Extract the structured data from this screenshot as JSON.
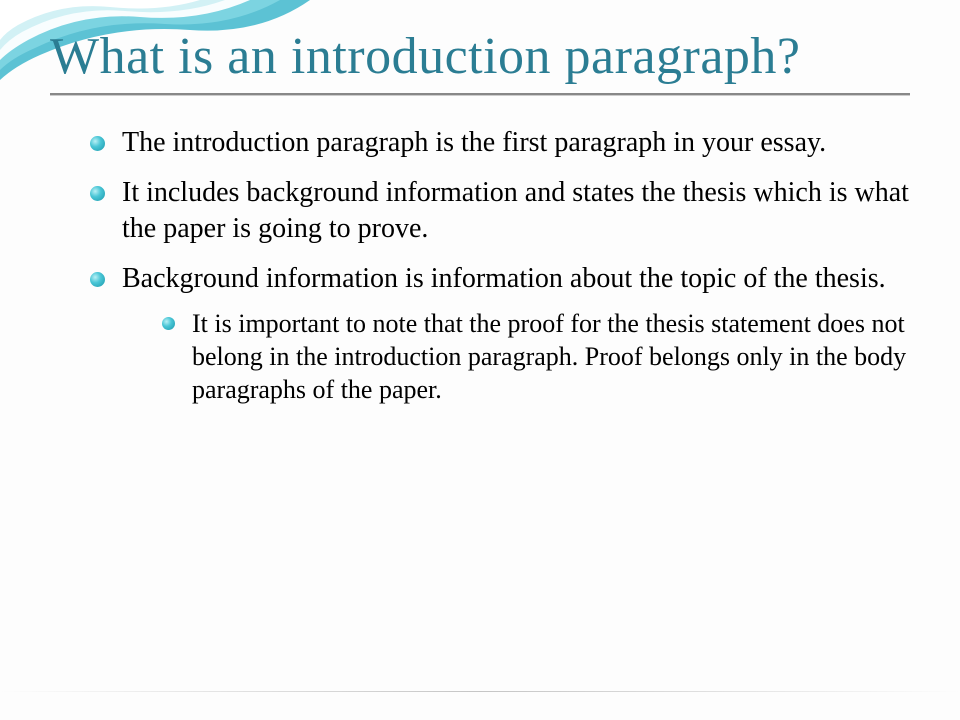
{
  "slide": {
    "title": "What is an introduction paragraph?",
    "bullets": [
      "The introduction paragraph is the first paragraph in your essay.",
      "It includes background information and states the thesis which is what the paper is going to prove.",
      "Background information is information about the topic of the thesis."
    ],
    "sub_bullets": [
      "It is important to note that the proof for the thesis statement does not belong in the introduction paragraph. Proof belongs only in the body paragraphs of the paper."
    ]
  },
  "theme": {
    "accent": "#2b7d93",
    "bullet_color": "#1a98ab"
  }
}
